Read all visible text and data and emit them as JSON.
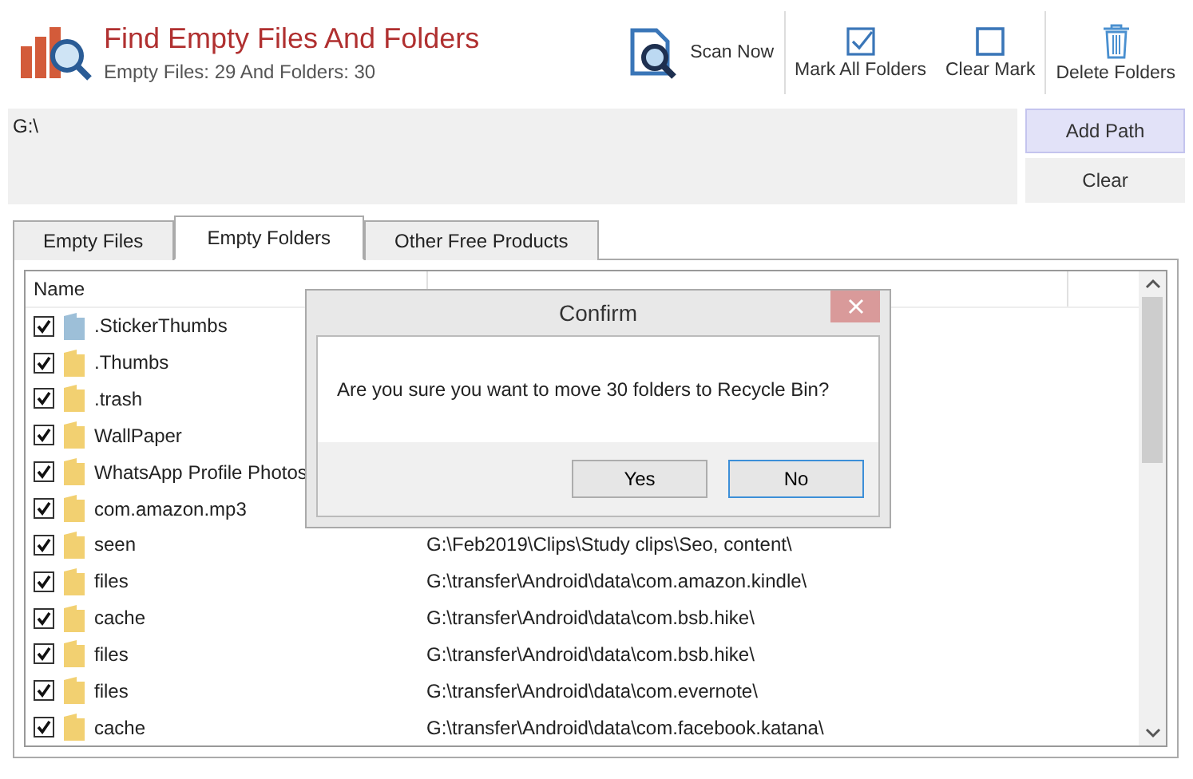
{
  "app": {
    "title": "Find Empty Files And Folders",
    "subtitle": "Empty Files: 29 And Folders: 30"
  },
  "toolbar": [
    {
      "kind": "scan",
      "label": "Scan Now"
    },
    {
      "kind": "mark",
      "label": "Mark All Folders"
    },
    {
      "kind": "clear",
      "label": "Clear Mark"
    },
    {
      "kind": "delete",
      "label": "Delete Folders"
    }
  ],
  "path_box": {
    "value": "G:\\"
  },
  "path_buttons": [
    {
      "label": "Add Path",
      "selected": true
    },
    {
      "label": "Clear",
      "selected": false
    }
  ],
  "tabs": [
    {
      "label": "Empty Files",
      "selected": false
    },
    {
      "label": "Empty Folders",
      "selected": true
    },
    {
      "label": "Other Free Products",
      "selected": false
    }
  ],
  "table": {
    "columns": [
      "Name"
    ],
    "rows": [
      {
        "name": ".StickerThumbs",
        "checked": true,
        "color": "#9dbfd8"
      },
      {
        "name": ".Thumbs",
        "checked": true,
        "color": "#f2d071"
      },
      {
        "name": ".trash",
        "checked": true,
        "color": "#f2d071"
      },
      {
        "name": "WallPaper",
        "checked": true,
        "color": "#f2d071"
      },
      {
        "name": "WhatsApp Profile Photos",
        "checked": true,
        "color": "#f2d071"
      },
      {
        "name": "com.amazon.mp3",
        "checked": true,
        "color": "#f2d071"
      },
      {
        "name": "seen",
        "checked": true,
        "color": "#f2d071",
        "path": "G:\\Feb2019\\Clips\\Study clips\\Seo, content\\"
      },
      {
        "name": "files",
        "checked": true,
        "color": "#f2d071",
        "path": "G:\\transfer\\Android\\data\\com.amazon.kindle\\"
      },
      {
        "name": "cache",
        "checked": true,
        "color": "#f2d071",
        "path": "G:\\transfer\\Android\\data\\com.bsb.hike\\"
      },
      {
        "name": "files",
        "checked": true,
        "color": "#f2d071",
        "path": "G:\\transfer\\Android\\data\\com.bsb.hike\\"
      },
      {
        "name": "files",
        "checked": true,
        "color": "#f2d071",
        "path": "G:\\transfer\\Android\\data\\com.evernote\\"
      },
      {
        "name": "cache",
        "checked": true,
        "color": "#f2d071",
        "path": "G:\\transfer\\Android\\data\\com.facebook.katana\\"
      }
    ]
  },
  "dialog": {
    "title": "Confirm",
    "message": "Are you sure you want to move 30 folders to Recycle Bin?",
    "buttons": [
      {
        "label": "Yes",
        "selected": false
      },
      {
        "label": "No",
        "selected": true
      }
    ]
  }
}
